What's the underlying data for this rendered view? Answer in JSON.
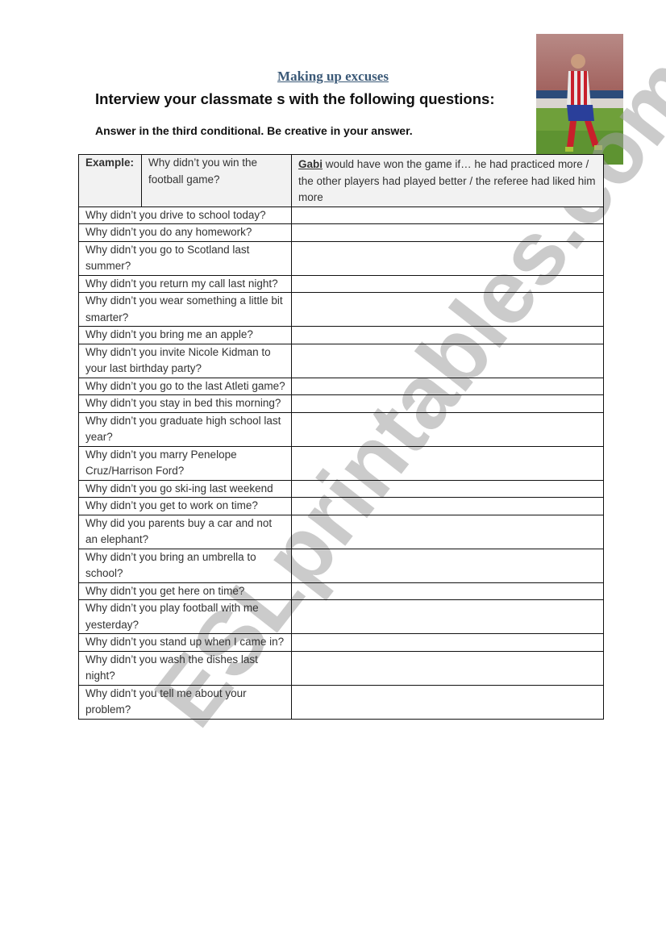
{
  "document": {
    "title": "Making up excuses",
    "subtitle": "Interview your classmate s with the following questions:",
    "instructions": "Answer in the third conditional. Be creative in your answer.",
    "photo_description": "Football player in red and white striped kit running on pitch"
  },
  "example": {
    "label": "Example:",
    "question": "Why didn’t you win the football game?",
    "answer_name": "Gabi",
    "answer_text": " would have won the game if… he had practiced more / the other players had played better / the referee had liked him more"
  },
  "questions": [
    "Why didn’t you drive to school today?",
    "Why didn’t you do any homework?",
    "Why didn’t you go to Scotland last summer?",
    "Why didn’t you return my call last night?",
    "Why didn’t you wear something a little bit smarter?",
    "Why didn’t you bring me an apple?",
    "Why didn’t you invite Nicole Kidman to your last birthday party?",
    "Why didn’t you go to the last Atleti game?",
    "Why didn’t you stay in bed this morning?",
    "Why didn’t you graduate high school last year?",
    "Why didn’t you marry Penelope Cruz/Harrison Ford?",
    "Why didn’t you go ski-ing last weekend",
    "Why didn’t you get to work on time?",
    "Why did you parents buy a car and not an elephant?",
    "Why didn’t you bring an umbrella to school?",
    "Why didn’t you get here on time?",
    "Why didn’t you play football with me yesterday?",
    "Why didn’t you stand up when I came in?",
    "Why didn’t you wash the dishes last night?",
    "Why didn’t you tell me about your problem?"
  ],
  "watermark": "ESLprintables.com"
}
